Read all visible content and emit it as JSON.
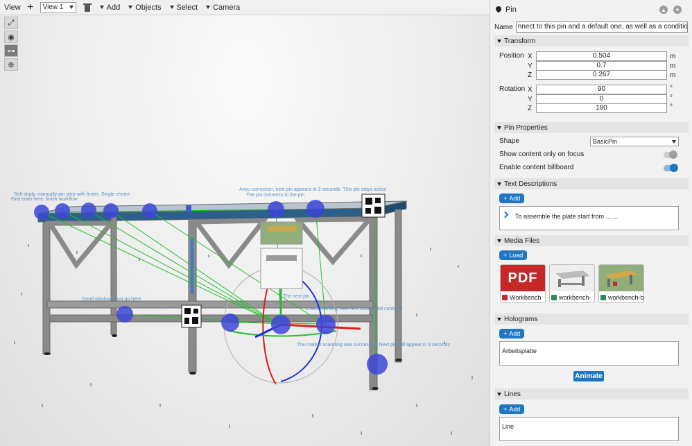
{
  "toolbar": {
    "view_label": "View",
    "add_view_icon": "plus-icon",
    "view_select": "View 1",
    "delete_icon": "trash-icon",
    "menus": [
      "Add",
      "Objects",
      "Select",
      "Camera"
    ]
  },
  "viewport": {
    "tools": [
      "expand-icon",
      "eye-icon",
      "key-icon",
      "move-gizmo-icon"
    ],
    "labels": [
      "Self study, manually pin step with finder, Single choice",
      "Grid ends here. finish workflow",
      "Ansu correction, next pin appears in 3 seconds. This pin stays active",
      "The pin connects to the pin",
      "Good window must go here",
      "The marker scanning was successful. Next pin will appear in 3 seconds",
      "The next pin",
      "Check Marking, see next button and continue"
    ]
  },
  "panel": {
    "title": "Pin",
    "name_label": "Name",
    "name_value": "nnect to this pin and a default one, as well as a condition node",
    "transform": {
      "header": "Transform",
      "position_label": "Position",
      "rotation_label": "Rotation",
      "position": [
        {
          "axis": "X",
          "value": "0.504",
          "unit": "m"
        },
        {
          "axis": "Y",
          "value": "0.7",
          "unit": "m"
        },
        {
          "axis": "Z",
          "value": "0.267",
          "unit": "m"
        }
      ],
      "rotation": [
        {
          "axis": "X",
          "value": "90",
          "unit": "°"
        },
        {
          "axis": "Y",
          "value": "0",
          "unit": "°"
        },
        {
          "axis": "Z",
          "value": "180",
          "unit": "°"
        }
      ]
    },
    "pin_properties": {
      "header": "Pin Properties",
      "shape_label": "Shape",
      "shape_value": "BasicPin",
      "show_focus_label": "Show content only on focus",
      "show_focus_on": false,
      "billboard_label": "Enable content billboard",
      "billboard_on": true
    },
    "text_descriptions": {
      "header": "Text Descriptions",
      "add_label": "Add",
      "items": [
        "To assemble the plate start from ......."
      ]
    },
    "media_files": {
      "header": "Media Files",
      "load_label": "Load",
      "items": [
        {
          "name": "Workbench",
          "type": "pdf",
          "thumb_text": "PDF"
        },
        {
          "name": "workbench-",
          "type": "image"
        },
        {
          "name": "workbench-b",
          "type": "image"
        }
      ]
    },
    "holograms": {
      "header": "Holograms",
      "add_label": "Add",
      "value": "Arbeitsplatte",
      "animate_label": "Animate"
    },
    "lines": {
      "header": "Lines",
      "add_label": "Add",
      "value": "Line"
    },
    "colors": {
      "accent": "#1f77c4",
      "pdf_red": "#c62828",
      "pin_blue": "#3b46d6",
      "table_top": "#2c5f8a"
    }
  }
}
